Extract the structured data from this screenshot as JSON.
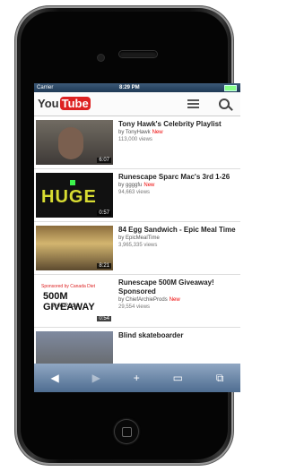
{
  "status": {
    "carrier": "Carrier",
    "time": "8:29 PM"
  },
  "header": {
    "logo_left": "You",
    "logo_right": "Tube"
  },
  "videos": [
    {
      "title": "Tony Hawk's Celebrity Playlist",
      "by": "by TonyHawk",
      "new": "New",
      "views": "113,000 views",
      "duration": "6:07"
    },
    {
      "title": "Runescape Sparc Mac's 3rd 1-26",
      "by": "by ggggfu",
      "new": "New",
      "views": "94,663 views",
      "duration": "0:57",
      "thumb_text": "HUGE"
    },
    {
      "title": "84 Egg Sandwich - Epic Meal Time",
      "by": "by EpicMealTime",
      "new": "",
      "views": "3,965,335 views",
      "duration": "8:21"
    },
    {
      "title": "Runescape 500M Giveaway! Sponsored",
      "by": "by ChiefArchieProds",
      "new": "New",
      "views": "29,554 views",
      "duration": "0:54",
      "thumb_line1": "Sponsored by Canada Diet",
      "thumb_line2": "500M GIVEAWAY",
      "thumb_line3": "Tree Rocks"
    },
    {
      "title": "Blind skateboarder",
      "by": "",
      "new": "",
      "views": "",
      "duration": ""
    }
  ],
  "toolbar": {
    "back": "◀",
    "forward": "▶",
    "add": "+",
    "bookmarks": "▭",
    "tabs": "⧉"
  }
}
